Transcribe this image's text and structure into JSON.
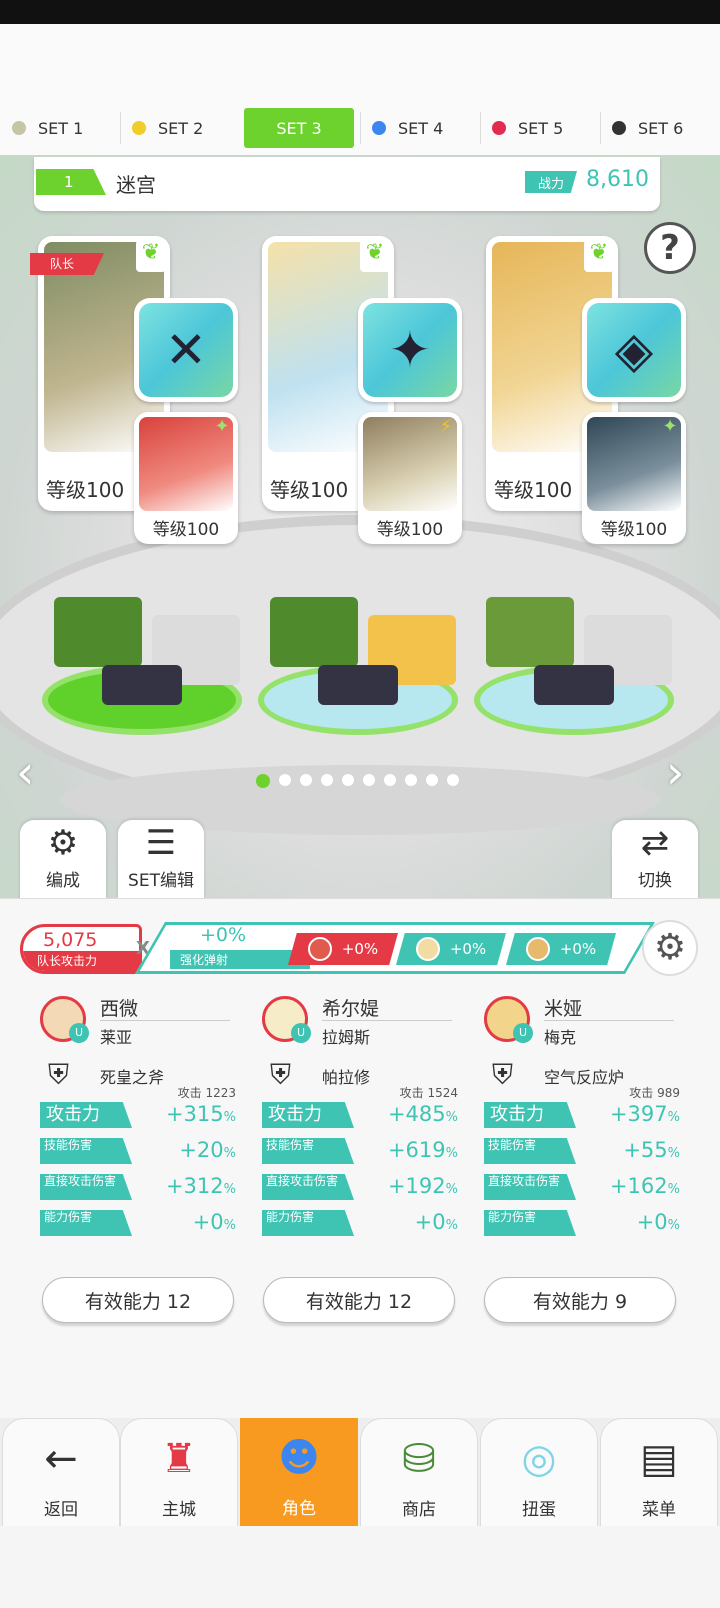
{
  "tabs": [
    {
      "label": "SET 1",
      "dot": "#c5c7a4"
    },
    {
      "label": "SET 2",
      "dot": "#f1cd28"
    },
    {
      "label": "SET 3",
      "dot": "",
      "active": true
    },
    {
      "label": "SET 4",
      "dot": "#3e86ef"
    },
    {
      "label": "SET 5",
      "dot": "#e32b4f"
    },
    {
      "label": "SET 6",
      "dot": "#333333"
    }
  ],
  "dungeon": {
    "level": "1",
    "name": "迷宫",
    "power_label": "战力",
    "power_value": "8,610"
  },
  "help_label": "?",
  "leader_badge": "队长",
  "heroes": [
    {
      "level": "等级100",
      "art": "#a9b08a",
      "sub_level": "等级100",
      "sub_art": "#e05a4d",
      "weapon": "✕"
    },
    {
      "level": "等级100",
      "art": "#f2dca4",
      "sub_level": "等级100",
      "sub_art": "#b8a98e",
      "weapon": "✦"
    },
    {
      "level": "等级100",
      "art": "#e7b96a",
      "sub_level": "等级100",
      "sub_art": "#3f5e6c",
      "weapon": "◈"
    }
  ],
  "controls": {
    "edit_label": "编成",
    "set_edit_label": "SET编辑",
    "switch_label": "切换"
  },
  "leader_attack": {
    "value": "5,075",
    "label": "队长攻击力"
  },
  "multiply": "X",
  "boost": {
    "value": "+0%",
    "label": "强化弹射",
    "chips": [
      "+0%",
      "+0%",
      "+0%"
    ]
  },
  "characters": [
    {
      "name": "西微",
      "sub": "莱亚",
      "weapon": "死皇之斧",
      "atk_small": "攻击 1223",
      "stats": [
        {
          "tag": "攻击力",
          "value": "+315"
        },
        {
          "tag": "技能伤害",
          "value": "+20"
        },
        {
          "tag": "直接攻击伤害",
          "value": "+312"
        },
        {
          "tag": "能力伤害",
          "value": "+0"
        }
      ],
      "effective": "有效能力 12"
    },
    {
      "name": "希尔媞",
      "sub": "拉姆斯",
      "weapon": "帕拉修",
      "atk_small": "攻击 1524",
      "stats": [
        {
          "tag": "攻击力",
          "value": "+485"
        },
        {
          "tag": "技能伤害",
          "value": "+619"
        },
        {
          "tag": "直接攻击伤害",
          "value": "+192"
        },
        {
          "tag": "能力伤害",
          "value": "+0"
        }
      ],
      "effective": "有效能力 12"
    },
    {
      "name": "米娅",
      "sub": "梅克",
      "weapon": "空气反应炉",
      "atk_small": "攻击 989",
      "stats": [
        {
          "tag": "攻击力",
          "value": "+397"
        },
        {
          "tag": "技能伤害",
          "value": "+55"
        },
        {
          "tag": "直接攻击伤害",
          "value": "+162"
        },
        {
          "tag": "能力伤害",
          "value": "+0"
        }
      ],
      "effective": "有效能力 9"
    }
  ],
  "percent": "%",
  "nav": [
    {
      "label": "返回",
      "icon": "back-arrow-icon"
    },
    {
      "label": "主城",
      "icon": "castle-icon"
    },
    {
      "label": "角色",
      "icon": "character-icon",
      "active": true
    },
    {
      "label": "商店",
      "icon": "shop-icon"
    },
    {
      "label": "扭蛋",
      "icon": "gacha-icon"
    },
    {
      "label": "菜单",
      "icon": "menu-icon"
    }
  ]
}
